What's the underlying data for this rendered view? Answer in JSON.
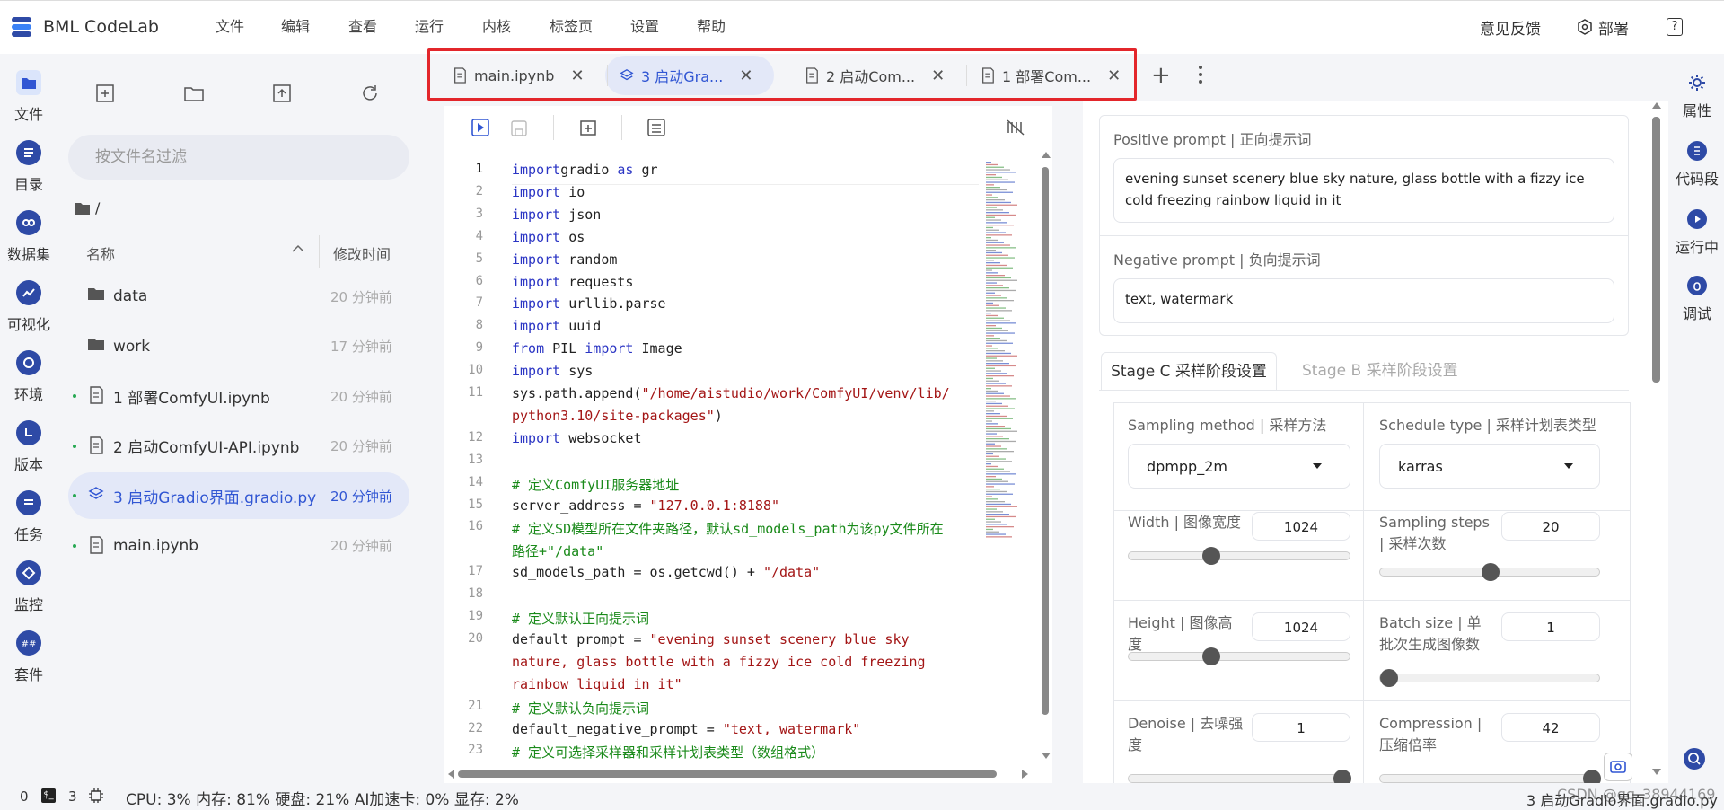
{
  "app": {
    "name": "BML CodeLab"
  },
  "menu": [
    "文件",
    "编辑",
    "查看",
    "运行",
    "内核",
    "标签页",
    "设置",
    "帮助"
  ],
  "top_right": {
    "feedback": "意见反馈",
    "deploy": "部署",
    "help_glyph": "?"
  },
  "activity": [
    {
      "label": "文件",
      "icon": "folder-icon"
    },
    {
      "label": "目录",
      "icon": "toc-icon"
    },
    {
      "label": "数据集",
      "icon": "dataset-icon"
    },
    {
      "label": "可视化",
      "icon": "chart-icon"
    },
    {
      "label": "环境",
      "icon": "environment-icon"
    },
    {
      "label": "版本",
      "icon": "version-icon"
    },
    {
      "label": "任务",
      "icon": "task-icon"
    },
    {
      "label": "监控",
      "icon": "monitor-icon"
    },
    {
      "label": "套件",
      "icon": "suite-icon"
    }
  ],
  "filebrowser": {
    "filter_placeholder": "按文件名过滤",
    "path": "/",
    "col_name": "名称",
    "col_modified": "修改时间",
    "items": [
      {
        "name": "data",
        "time": "20 分钟前",
        "type": "folder"
      },
      {
        "name": "work",
        "time": "17 分钟前",
        "type": "folder"
      },
      {
        "name": "1 部署ComfyUI.ipynb",
        "time": "20 分钟前",
        "type": "notebook"
      },
      {
        "name": "2 启动ComfyUI-API.ipynb",
        "time": "20 分钟前",
        "type": "notebook"
      },
      {
        "name": "3 启动Gradio界面.gradio.py",
        "time": "20 分钟前",
        "type": "gradio",
        "selected": true
      },
      {
        "name": "main.ipynb",
        "time": "20 分钟前",
        "type": "notebook"
      }
    ]
  },
  "tabs": [
    {
      "label": "main.ipynb"
    },
    {
      "label": "3 启动Gra...",
      "active": true
    },
    {
      "label": "2 启动Com..."
    },
    {
      "label": "1 部署Com..."
    }
  ],
  "code_lines": [
    {
      "n": "1",
      "parts": [
        [
          "kw",
          "import"
        ],
        [
          "",
          "gradio "
        ],
        [
          "kw",
          "as"
        ],
        [
          "",
          " gr"
        ]
      ]
    },
    {
      "n": "2",
      "parts": [
        [
          "kw",
          "import"
        ],
        [
          "",
          " io"
        ]
      ]
    },
    {
      "n": "3",
      "parts": [
        [
          "kw",
          "import"
        ],
        [
          "",
          " json"
        ]
      ]
    },
    {
      "n": "4",
      "parts": [
        [
          "kw",
          "import"
        ],
        [
          "",
          " os"
        ]
      ]
    },
    {
      "n": "5",
      "parts": [
        [
          "kw",
          "import"
        ],
        [
          "",
          " random"
        ]
      ]
    },
    {
      "n": "6",
      "parts": [
        [
          "kw",
          "import"
        ],
        [
          "",
          " requests"
        ]
      ]
    },
    {
      "n": "7",
      "parts": [
        [
          "kw",
          "import"
        ],
        [
          "",
          " urllib.parse"
        ]
      ]
    },
    {
      "n": "8",
      "parts": [
        [
          "kw",
          "import"
        ],
        [
          "",
          " uuid"
        ]
      ]
    },
    {
      "n": "9",
      "parts": [
        [
          "kw",
          "from"
        ],
        [
          "",
          " PIL "
        ],
        [
          "kw",
          "import"
        ],
        [
          "",
          " Image"
        ]
      ]
    },
    {
      "n": "10",
      "parts": [
        [
          "kw",
          "import"
        ],
        [
          "",
          " sys"
        ]
      ]
    },
    {
      "n": "11",
      "parts": [
        [
          "",
          "sys.path.append("
        ],
        [
          "str",
          "\"/home/aistudio/work/ComfyUI/venv/lib/"
        ]
      ]
    },
    {
      "n": "",
      "parts": [
        [
          "str",
          "python3.10/site-packages\""
        ],
        [
          "",
          ")"
        ]
      ]
    },
    {
      "n": "12",
      "parts": [
        [
          "kw",
          "import"
        ],
        [
          "",
          " websocket"
        ]
      ]
    },
    {
      "n": "13",
      "parts": []
    },
    {
      "n": "14",
      "parts": [
        [
          "cm",
          "# 定义ComfyUI服务器地址"
        ]
      ]
    },
    {
      "n": "15",
      "parts": [
        [
          "",
          "server_address = "
        ],
        [
          "str",
          "\"127.0.0.1:8188\""
        ]
      ]
    },
    {
      "n": "16",
      "parts": [
        [
          "cm",
          "# 定义SD模型所在文件夹路径，默认sd_models_path为该py文件所在"
        ]
      ]
    },
    {
      "n": "",
      "parts": [
        [
          "cm",
          "路径+\"/data\""
        ]
      ]
    },
    {
      "n": "17",
      "parts": [
        [
          "",
          "sd_models_path = os.getcwd() + "
        ],
        [
          "str",
          "\"/data\""
        ]
      ]
    },
    {
      "n": "18",
      "parts": []
    },
    {
      "n": "19",
      "parts": [
        [
          "cm",
          "# 定义默认正向提示词"
        ]
      ]
    },
    {
      "n": "20",
      "parts": [
        [
          "",
          "default_prompt = "
        ],
        [
          "str",
          "\"evening sunset scenery blue sky"
        ]
      ]
    },
    {
      "n": "",
      "parts": [
        [
          "str",
          "nature, glass bottle with a fizzy ice cold freezing"
        ]
      ]
    },
    {
      "n": "",
      "parts": [
        [
          "str",
          "rainbow liquid in it\""
        ]
      ]
    },
    {
      "n": "21",
      "parts": [
        [
          "cm",
          "# 定义默认负向提示词"
        ]
      ]
    },
    {
      "n": "22",
      "parts": [
        [
          "",
          "default_negative_prompt = "
        ],
        [
          "str",
          "\"text, watermark\""
        ]
      ]
    },
    {
      "n": "23",
      "parts": [
        [
          "cm",
          "# 定义可选择采样器和采样计划表类型（数组格式）"
        ]
      ]
    }
  ],
  "gradio": {
    "positive_label": "Positive prompt | 正向提示词",
    "positive_value": "evening sunset scenery blue sky nature, glass bottle with a fizzy ice cold freezing rainbow liquid in it",
    "negative_label": "Negative prompt | 负向提示词",
    "negative_value": "text, watermark",
    "tab_c": "Stage C 采样阶段设置",
    "tab_b": "Stage B 采样阶段设置",
    "sampling_method_label": "Sampling method | 采样方法",
    "sampling_method_value": "dpmpp_2m",
    "schedule_label": "Schedule type | 采样计划表类型",
    "schedule_value": "karras",
    "width_label": "Width | 图像宽度",
    "width_value": "1024",
    "width_fraction": 0.36,
    "steps_label": "Sampling steps | 采样次数",
    "steps_value": "20",
    "steps_fraction": 0.5,
    "height_label": "Height | 图像高度",
    "height_value": "1024",
    "height_fraction": 0.36,
    "batch_label": "Batch size | 单批次生成图像数",
    "batch_value": "1",
    "batch_fraction": 0.0,
    "denoise_label": "Denoise | 去噪强度",
    "denoise_value": "1",
    "denoise_fraction": 1.0,
    "compression_label": "Compression | 压缩倍率",
    "compression_value": "42",
    "compression_fraction": 1.0
  },
  "rside": [
    {
      "label": "属性",
      "icon": "gear-icon"
    },
    {
      "label": "代码段",
      "icon": "snippet-icon"
    },
    {
      "label": "运行中",
      "icon": "running-icon"
    },
    {
      "label": "调试",
      "icon": "debug-icon"
    }
  ],
  "status": {
    "n1": "0",
    "terminals": "3",
    "metrics": "CPU: 3% 内存: 81% 硬盘: 21% AI加速卡: 0% 显存: 2%",
    "right": "3 启动Gradio界面.gradio.py",
    "watermark": "CSDN @qq_38944169"
  },
  "colors": {
    "accent": "#3156d3",
    "highlight_box": "#e3262b"
  }
}
